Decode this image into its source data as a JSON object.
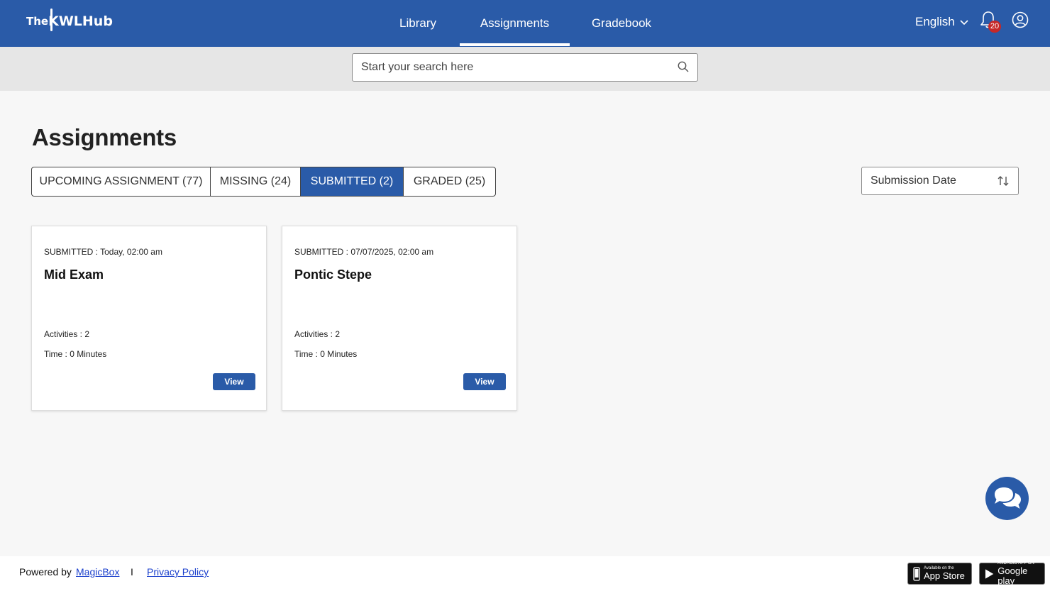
{
  "header": {
    "logo_the": "The",
    "logo_k": "K",
    "logo_rest": "WLHub",
    "nav": [
      "Library",
      "Assignments",
      "Gradebook"
    ],
    "active_nav": "Assignments",
    "language": "English",
    "notification_count": "20"
  },
  "search": {
    "placeholder": "Start your search here"
  },
  "page": {
    "title": "Assignments"
  },
  "tabs": [
    {
      "label": "UPCOMING ASSIGNMENT (77)",
      "active": false
    },
    {
      "label": "MISSING (24)",
      "active": false
    },
    {
      "label": "SUBMITTED (2)",
      "active": true
    },
    {
      "label": "GRADED (25)",
      "active": false
    }
  ],
  "sort": {
    "label": "Submission Date"
  },
  "cards": [
    {
      "submitted": "SUBMITTED : Today, 02:00 am",
      "title": "Mid Exam",
      "activities": "Activities : 2",
      "time": "Time : 0 Minutes",
      "button": "View"
    },
    {
      "submitted": "SUBMITTED : 07/07/2025, 02:00 am",
      "title": "Pontic Stepe",
      "activities": "Activities : 2",
      "time": "Time : 0 Minutes",
      "button": "View"
    }
  ],
  "footer": {
    "powered_by": "Powered by",
    "magicbox": "MagicBox",
    "separator": "I",
    "privacy": "Privacy Policy",
    "appstore_small": "Available on the",
    "appstore_big": "App Store",
    "gplay_small": "ANDROID APP ON",
    "gplay_big": "Google play"
  },
  "colors": {
    "primary": "#2a5ba8",
    "badge": "#c62828",
    "link": "#1a3fcc"
  }
}
